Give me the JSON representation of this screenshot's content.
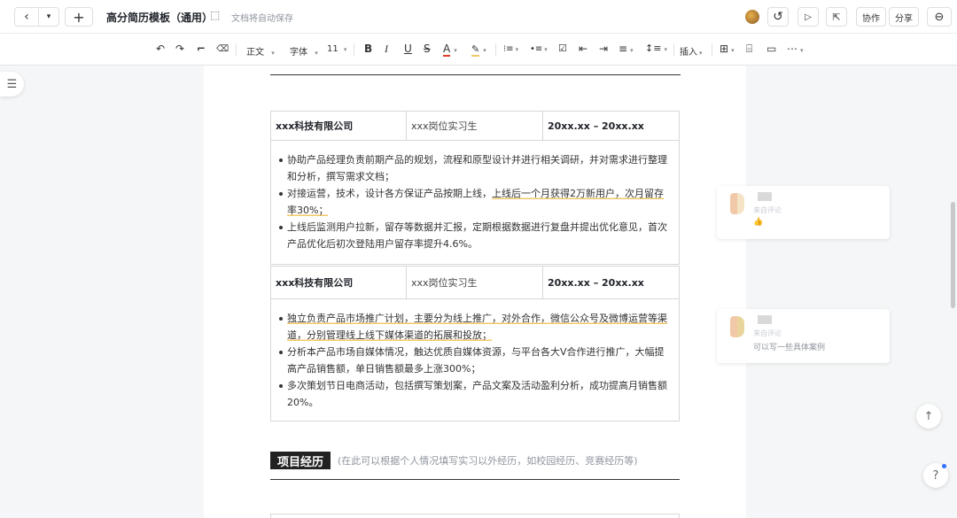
{
  "header": {
    "back_icon": "‹",
    "dropdown_icon": "▾",
    "add_icon": "+",
    "title": "高分简历模板（通用）",
    "bookmark_icon": "⬚",
    "autosave_text": "文档将自动保存",
    "history_icon": "↺",
    "present_icon": "▷",
    "share_screen_icon": "⇱",
    "collab_label": "协作",
    "share_label": "分享",
    "more_icon": "⊖"
  },
  "toolbar": {
    "undo": "↶",
    "redo": "↷",
    "format_painter": "⌐",
    "clear_format": "⌫",
    "paragraph_style": "正文",
    "font_family": "字体",
    "font_size": "11",
    "bold": "B",
    "italic": "I",
    "underline": "U",
    "strikethrough": "S",
    "font_color": "A",
    "highlight": "✎",
    "ordered_list": "⁝≡",
    "bullet_list": "•≡",
    "task_list": "☑",
    "indent_left": "⇤",
    "indent_right": "⇥",
    "align": "≡",
    "line_height": "↕≡",
    "insert": "插入",
    "table": "⊞",
    "image": "⌸",
    "comment": "▭",
    "more": "⋯",
    "caret": "▾"
  },
  "sidebar": {
    "outline_icon": "☰"
  },
  "document": {
    "jobs": [
      {
        "company": "xxx科技有限公司",
        "position": "xxx岗位实习生",
        "period": "20xx.xx – 20xx.xx",
        "bullets": [
          {
            "pre": "协助产品经理负责前期产品的规划，流程和原型设计并进行相关调研，并对需求进行整理和分析，撰写需求文档；",
            "hl": "",
            "post": ""
          },
          {
            "pre": "对接运营，技术，设计各方保证产品按期上线，",
            "hl": "上线后一个月获得2万新用户，次月留存率30%；",
            "post": ""
          },
          {
            "pre": "上线后监测用户拉新，留存等数据并汇报，定期根据数据进行复盘并提出优化意见，首次产品优化后初次登陆用户留存率提升4.6%。",
            "hl": "",
            "post": ""
          }
        ]
      },
      {
        "company": "xxx科技有限公司",
        "position": "xxx岗位实习生",
        "period": "20xx.xx – 20xx.xx",
        "bullets": [
          {
            "pre": "",
            "hl": "独立负责产品市场推广计划，主要分为线上推广，对外合作，微信公众号及微博运营等渠道，分别管理线上线下媒体渠道的拓展和投放；",
            "post": ""
          },
          {
            "pre": "分析本产品市场自媒体情况，触达优质自媒体资源，与平台各大V合作进行推广，大幅提高产品销售额，单日销售额最多上涨300%；",
            "hl": "",
            "post": ""
          },
          {
            "pre": "多次策划节日电商活动，包括撰写策划案，产品文案及活动盈利分析，成功提高月销售额20%。",
            "hl": "",
            "post": ""
          }
        ]
      }
    ],
    "section_title": "项目经历",
    "section_note": "(在此可以根据个人情况填写实习以外经历，如校园经历、竞赛经历等)"
  },
  "comments": [
    {
      "sub": "来自评论",
      "text": "👍"
    },
    {
      "sub": "来自评论",
      "text": "可以写一些具体案例"
    }
  ],
  "float": {
    "back_to_top": "↑",
    "help": "?"
  }
}
